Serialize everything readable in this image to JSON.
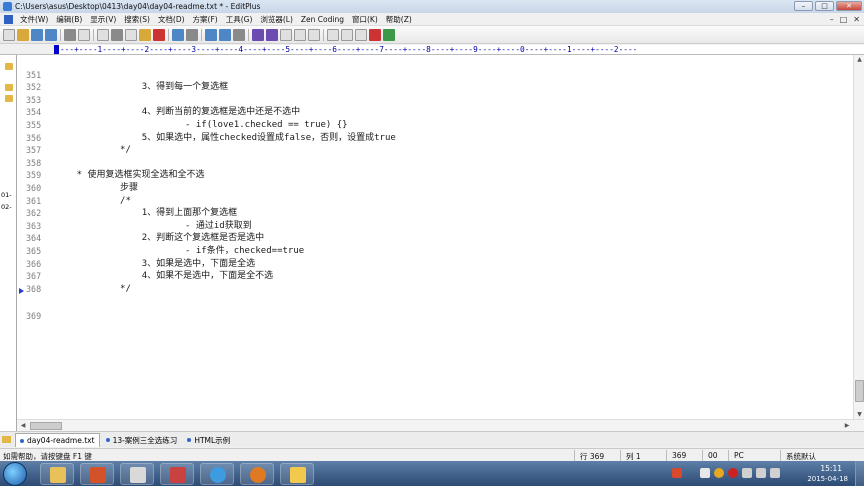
{
  "window": {
    "title": "C:\\Users\\asus\\Desktop\\0413\\day04\\day04-readme.txt * - EditPlus",
    "controls": {
      "minimize": "–",
      "maximize": "□",
      "close": "✕"
    }
  },
  "menu": {
    "items": [
      "文件(W)",
      "编辑(B)",
      "显示(V)",
      "搜索(S)",
      "文档(D)",
      "方案(F)",
      "工具(G)",
      "浏览器(L)",
      "Zen Coding",
      "窗口(K)",
      "帮助(Z)"
    ],
    "right_controls": [
      "–",
      "□",
      "✕"
    ]
  },
  "ruler": {
    "text": "---+----1----+----2----+----3----+----4----+----5----+----6----+----7----+----8----+----9----+----0----+----1----+----2----"
  },
  "left_strip": {
    "labels": [
      "01-",
      "02-"
    ]
  },
  "editor": {
    "lines": [
      {
        "num": "351",
        "text": "                3、得到每一个复选框"
      },
      {
        "num": "352",
        "text": ""
      },
      {
        "num": "353",
        "text": "                4、判断当前的复选框是选中还是不选中"
      },
      {
        "num": "354",
        "text": "                        - if(love1.checked == true) {}"
      },
      {
        "num": "355",
        "text": "                5、如果选中，属性checked设置成false，否则，设置成true"
      },
      {
        "num": "356",
        "text": "            */"
      },
      {
        "num": "357",
        "text": ""
      },
      {
        "num": "358",
        "text": "    * 使用复选框实现全选和全不选"
      },
      {
        "num": "359",
        "text": "            步骤"
      },
      {
        "num": "360",
        "text": "            /*"
      },
      {
        "num": "361",
        "text": "                1、得到上面那个复选框"
      },
      {
        "num": "362",
        "text": "                        - 通过id获取到"
      },
      {
        "num": "363",
        "text": "                2、判断这个复选框是否是选中"
      },
      {
        "num": "364",
        "text": "                        - if条件，checked==true"
      },
      {
        "num": "365",
        "text": "                3、如果是选中，下面是全选"
      },
      {
        "num": "366",
        "text": "                4、如果不是选中，下面是全不选"
      },
      {
        "num": "367",
        "text": "            */"
      },
      {
        "num": "368",
        "text": ""
      },
      {
        "num": "369",
        "text": ""
      }
    ],
    "current_line": "369"
  },
  "tabs": [
    {
      "label": "day04-readme.txt",
      "active": true
    },
    {
      "label": "13-案例三全选练习",
      "active": false
    },
    {
      "label": "HTML示例",
      "active": false
    }
  ],
  "status": {
    "help": "如需帮助，请按键盘 F1 键",
    "line": "行 369",
    "col": "列 1",
    "total": "369",
    "code": "00",
    "mode": "PC",
    "encoding": "系统默认"
  },
  "taskbar": {
    "time": "15:11",
    "date": "2015-04-18"
  }
}
